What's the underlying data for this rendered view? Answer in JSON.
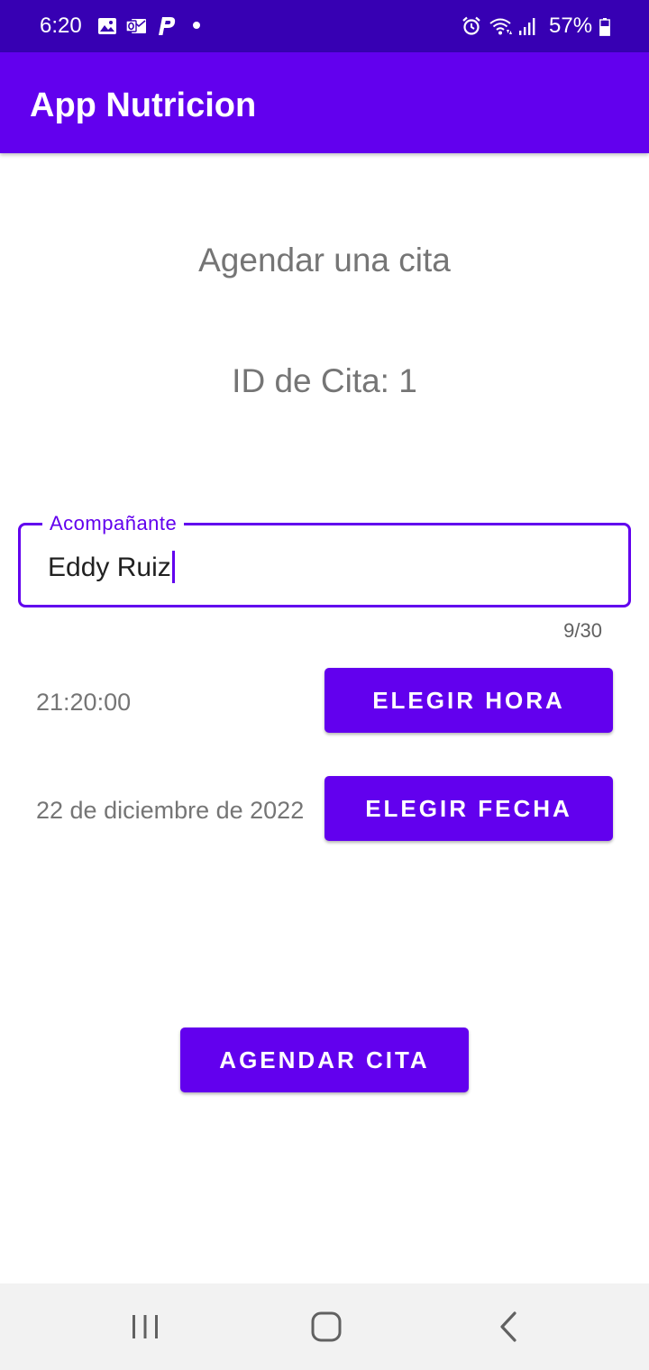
{
  "status_bar": {
    "time": "6:20",
    "battery": "57%",
    "icons": [
      "gallery-icon",
      "outlook-icon",
      "p-icon",
      "dot-icon",
      "alarm-icon",
      "wifi-icon",
      "signal-icon",
      "battery-icon"
    ]
  },
  "app_bar": {
    "title": "App Nutricion",
    "color": "#6200ee"
  },
  "main": {
    "page_title": "Agendar una cita",
    "cita_id": "ID de Cita: 1",
    "companion_field": {
      "label": "Acompañante",
      "value": "Eddy Ruiz",
      "counter": "9/30"
    },
    "time": {
      "value": "21:20:00",
      "button_label": "ELEGIR HORA"
    },
    "date": {
      "value": "22 de diciembre de 2022",
      "button_label": "ELEGIR FECHA"
    },
    "submit_label": "AGENDAR CITA"
  },
  "nav_bar": {
    "icons": [
      "recents-icon",
      "home-icon",
      "back-icon"
    ]
  },
  "colors": {
    "status_bar": "#3700b3",
    "primary": "#6200ee",
    "secondary_text": "#757575"
  }
}
